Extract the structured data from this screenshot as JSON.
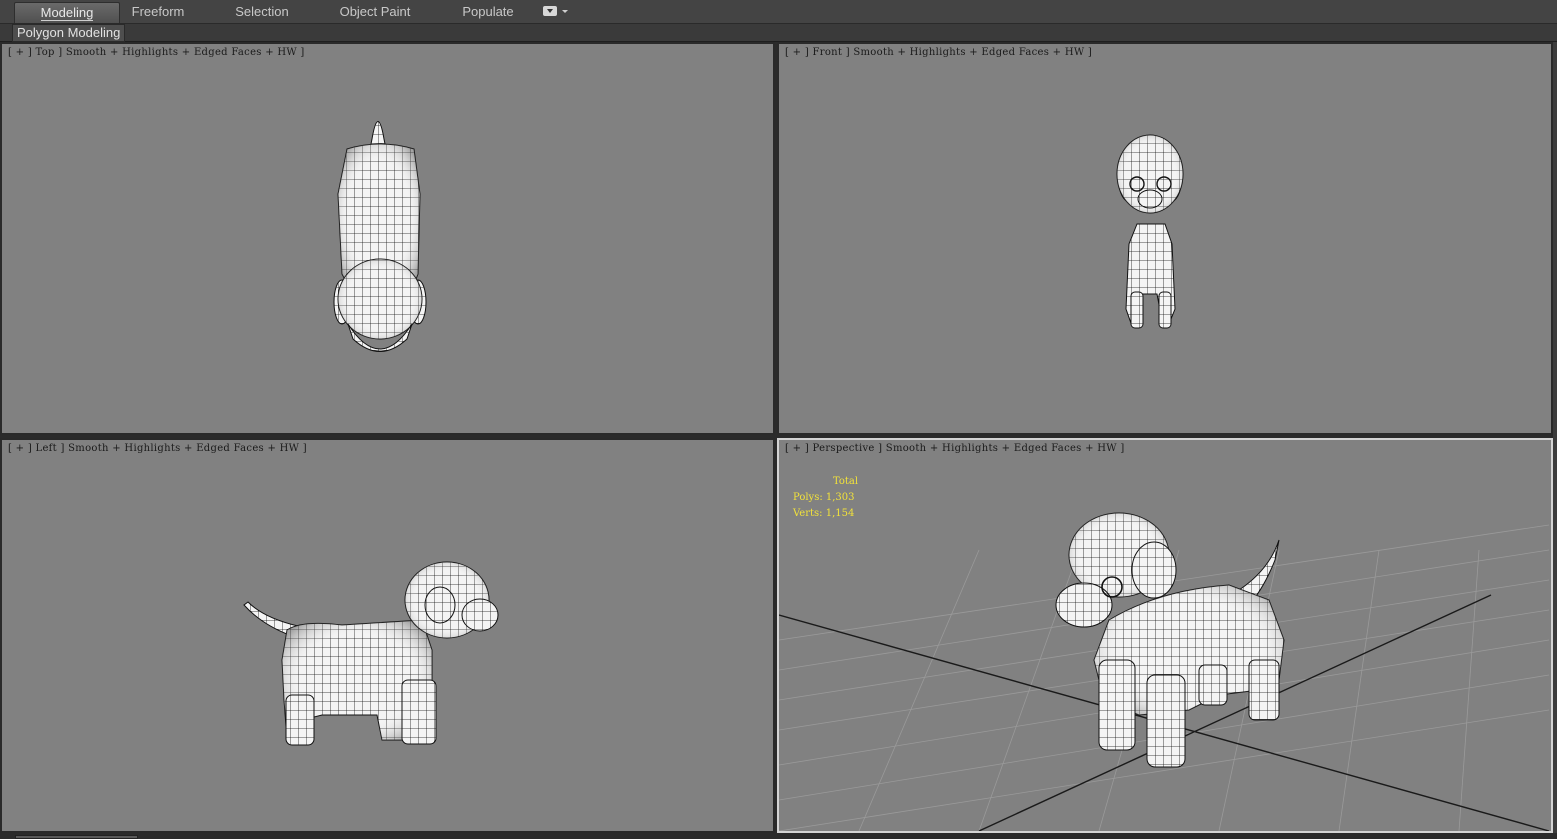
{
  "ribbon": {
    "tabs": [
      {
        "label": "Modeling",
        "active": true
      },
      {
        "label": "Freeform",
        "active": false
      },
      {
        "label": "Selection",
        "active": false
      },
      {
        "label": "Object Paint",
        "active": false
      },
      {
        "label": "Populate",
        "active": false
      }
    ],
    "panel_label": "Polygon Modeling"
  },
  "viewports": {
    "top": {
      "label": "[ + ] Top ] Smooth + Highlights + Edged Faces + HW ]"
    },
    "front": {
      "label": "[ + ] Front ] Smooth + Highlights + Edged Faces + HW ]"
    },
    "left": {
      "label": "[ + ] Left ] Smooth + Highlights + Edged Faces + HW ]"
    },
    "perspective": {
      "label": "[ + ] Perspective ] Smooth + Highlights + Edged Faces + HW ]"
    }
  },
  "stats": {
    "total": "Total",
    "polys": "Polys: 1,303",
    "verts": "Verts: 1,154"
  },
  "colors": {
    "viewport_bg": "#818181",
    "stats_text": "#f2e23a",
    "active_border": "#d4d4d4",
    "mesh_fill": "#f4f4f4",
    "wire": "#111111"
  }
}
